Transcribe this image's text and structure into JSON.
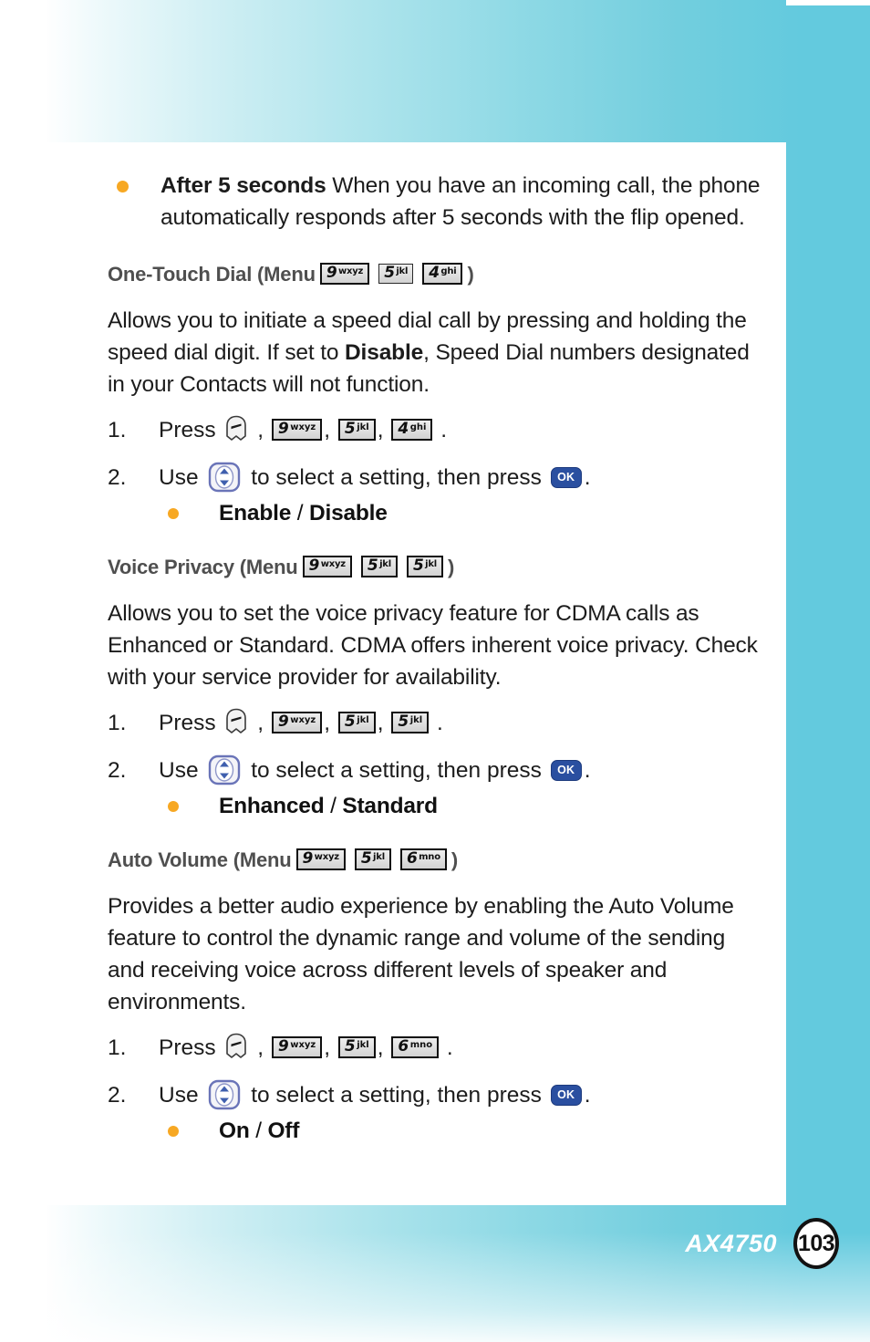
{
  "page": {
    "model": "AX4750",
    "number": "103"
  },
  "colors": {
    "bullet_orange": "#f7a823",
    "heading_gray": "#4f4f4f",
    "ok_blue": "#2a4fa0",
    "nav_blue": "#3f5fae",
    "page_cyan": "#63cade"
  },
  "top_bullet": {
    "bold_lead": "After 5 seconds",
    "text": " When you have an incoming call, the phone automatically responds after 5 seconds with the flip opened."
  },
  "sections": [
    {
      "id": "one-touch-dial",
      "heading_label": "One-Touch Dial (Menu",
      "heading_close": ")",
      "heading_keys": [
        {
          "num": "9",
          "letters": "wxyz",
          "thin": false
        },
        {
          "num": "5",
          "letters": "jkl",
          "thin": true
        },
        {
          "num": "4",
          "letters": "ghi",
          "thin": false
        }
      ],
      "body": "Allows you to initiate a speed dial call by pressing and holding the speed dial digit. If set to ",
      "body_bold": "Disable",
      "body_tail": ", Speed Dial numbers designated in your Contacts will not function.",
      "steps": [
        {
          "num": "1.",
          "lead": "Press",
          "menu_icon": "menu-key-icon",
          "keys": [
            {
              "num": "9",
              "letters": "wxyz",
              "thin": false
            },
            {
              "num": "5",
              "letters": "jkl",
              "thin": false
            },
            {
              "num": "4",
              "letters": "ghi",
              "thin": false
            }
          ],
          "end": "."
        },
        {
          "num": "2.",
          "lead": "Use",
          "nav_icon": "nav-up-down-icon",
          "mid": "to select a setting, then press",
          "ok_label": "OK",
          "end": "."
        }
      ],
      "options": {
        "first": "Enable",
        "sep": " / ",
        "second": "Disable"
      }
    },
    {
      "id": "voice-privacy",
      "heading_label": "Voice Privacy (Menu",
      "heading_close": ")",
      "heading_keys": [
        {
          "num": "9",
          "letters": "wxyz",
          "thin": false
        },
        {
          "num": "5",
          "letters": "jkl",
          "thin": false
        },
        {
          "num": "5",
          "letters": "jkl",
          "thin": false
        }
      ],
      "body": "Allows you to set the voice privacy feature for CDMA calls as Enhanced or Standard. CDMA offers inherent voice privacy. Check with your service provider for availability.",
      "body_bold": "",
      "body_tail": "",
      "steps": [
        {
          "num": "1.",
          "lead": "Press",
          "menu_icon": "menu-key-icon",
          "keys": [
            {
              "num": "9",
              "letters": "wxyz",
              "thin": false
            },
            {
              "num": "5",
              "letters": "jkl",
              "thin": false
            },
            {
              "num": "5",
              "letters": "jkl",
              "thin": false
            }
          ],
          "end": "."
        },
        {
          "num": "2.",
          "lead": "Use",
          "nav_icon": "nav-up-down-icon",
          "mid": "to select a setting, then press",
          "ok_label": "OK",
          "end": "."
        }
      ],
      "options": {
        "first": "Enhanced",
        "sep": " / ",
        "second": "Standard"
      }
    },
    {
      "id": "auto-volume",
      "heading_label": "Auto Volume (Menu",
      "heading_close": ")",
      "heading_keys": [
        {
          "num": "9",
          "letters": "wxyz",
          "thin": false
        },
        {
          "num": "5",
          "letters": "jkl",
          "thin": false
        },
        {
          "num": "6",
          "letters": "mno",
          "thin": false
        }
      ],
      "body": "Provides a better audio experience by enabling the Auto Volume feature to control the dynamic range and volume of the sending and receiving voice across different levels of speaker and environments.",
      "body_bold": "",
      "body_tail": "",
      "steps": [
        {
          "num": "1.",
          "lead": "Press",
          "menu_icon": "menu-key-icon",
          "keys": [
            {
              "num": "9",
              "letters": "wxyz",
              "thin": false
            },
            {
              "num": "5",
              "letters": "jkl",
              "thin": false
            },
            {
              "num": "6",
              "letters": "mno",
              "thin": false
            }
          ],
          "end": "."
        },
        {
          "num": "2.",
          "lead": "Use",
          "nav_icon": "nav-up-down-icon",
          "mid": "to select a setting, then press",
          "ok_label": "OK",
          "end": "."
        }
      ],
      "options": {
        "first": "On",
        "sep": " / ",
        "second": "Off"
      }
    }
  ]
}
